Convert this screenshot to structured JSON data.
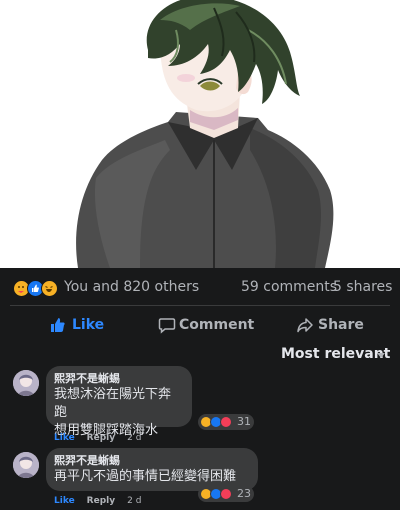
{
  "post": {
    "image_description_icon": "anime-portrait-image"
  },
  "summary": {
    "reactions_text": "You and 820 others",
    "comments_text": "59 comments",
    "shares_text": "5 shares"
  },
  "actions": {
    "like_label": "Like",
    "comment_label": "Comment",
    "share_label": "Share"
  },
  "sort": {
    "label": "Most relevant"
  },
  "comments": [
    {
      "author": "熙羿不是蜥蜴",
      "lines": [
        "我想沐浴在陽光下奔跑",
        "想用雙腿踩踏海水"
      ],
      "like_label": "Like",
      "reply_label": "Reply",
      "time": "2 d",
      "reaction_count": "31"
    },
    {
      "author": "熙羿不是蜥蜴",
      "lines": [
        "再平凡不過的事情已經變得困難"
      ],
      "like_label": "Like",
      "reply_label": "Reply",
      "time": "2 d",
      "reaction_count": "23"
    }
  ],
  "colors": {
    "background": "#18191a",
    "bubble": "#3a3b3c",
    "accent_blue": "#2d88ff",
    "text_primary": "#e4e6eb",
    "text_secondary": "#b0b3b8"
  }
}
